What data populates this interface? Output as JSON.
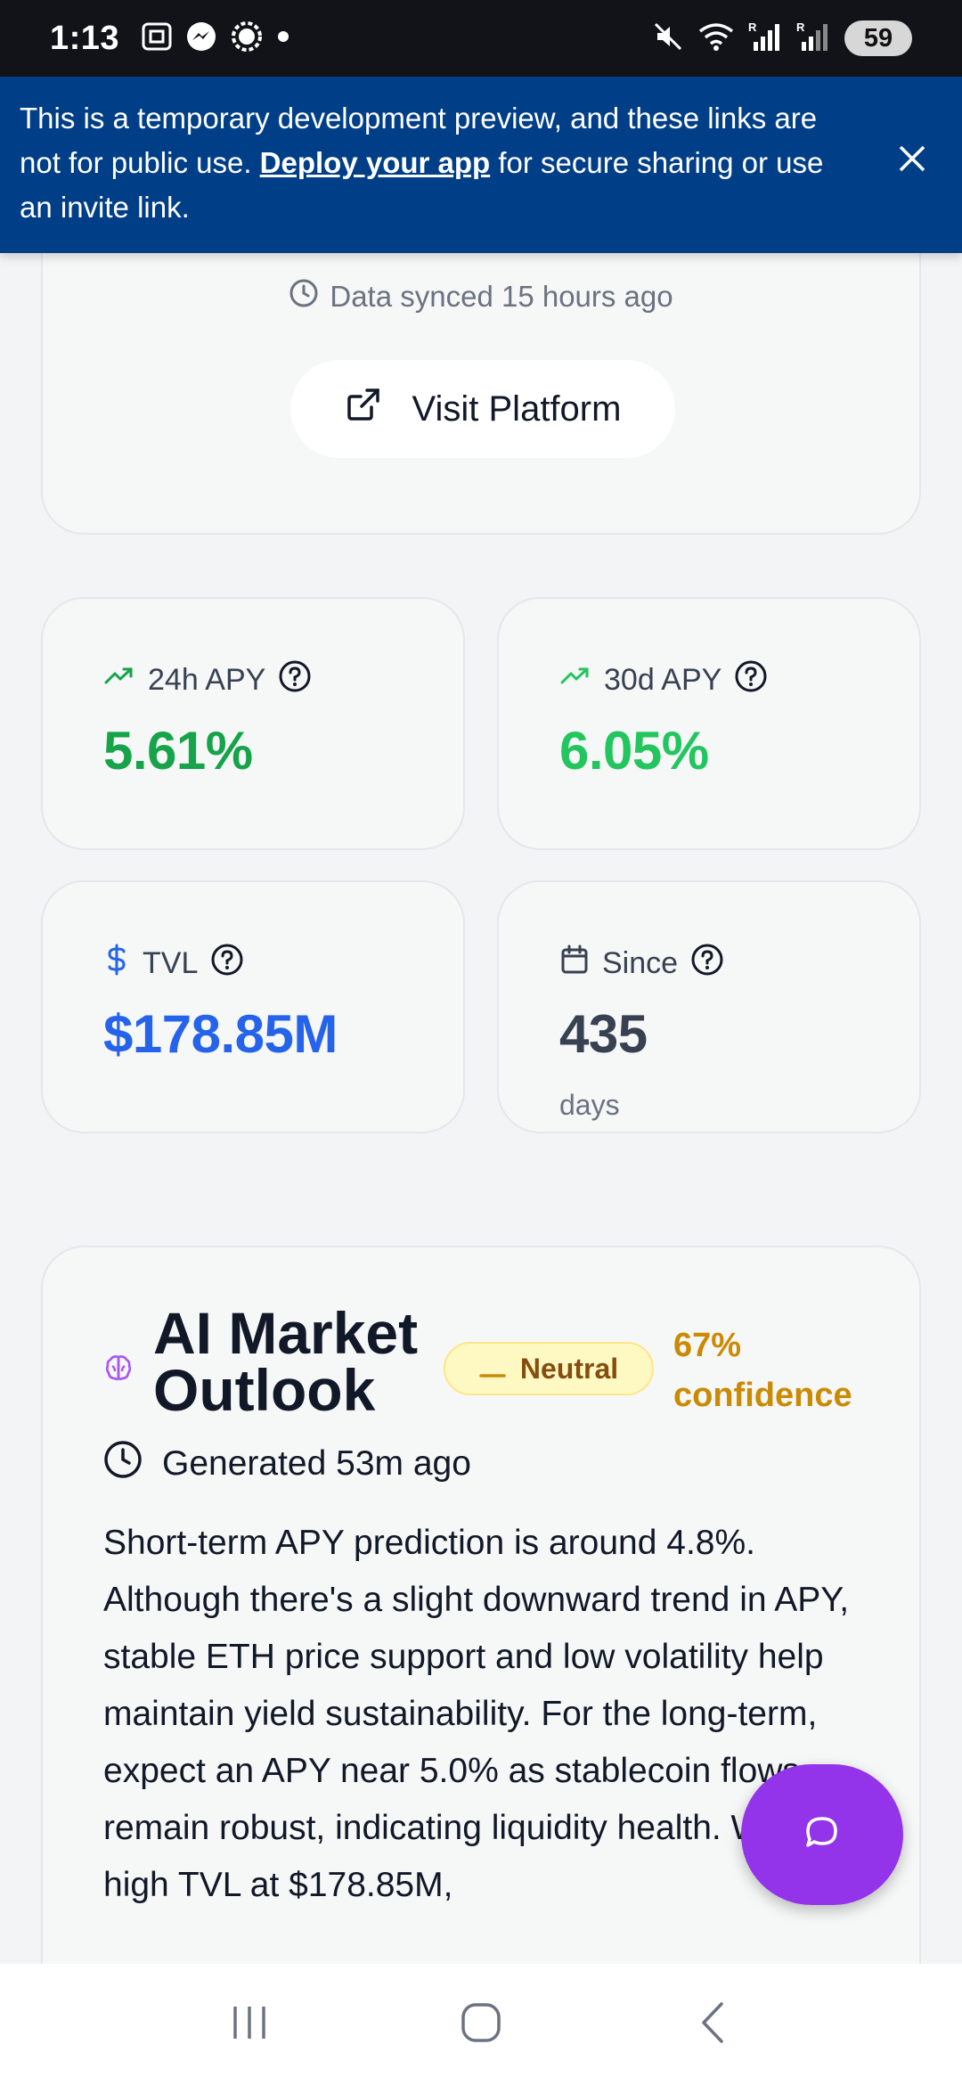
{
  "status_bar": {
    "time": "1:13",
    "battery": "59",
    "icons": [
      "screenshot-icon",
      "messenger-icon",
      "settings-icon",
      "dot-icon",
      "mute-icon",
      "wifi-icon",
      "signal-icon",
      "signal-icon-2"
    ]
  },
  "dev_banner": {
    "text_before": "This is a temporary development preview, and these links are not for public use. ",
    "link_text": "Deploy your app",
    "text_after": " for secure sharing or use an invite link.",
    "close_icon": "close-icon"
  },
  "platform_card": {
    "sync_text": "Data synced 15 hours ago",
    "visit_button": "Visit Platform"
  },
  "stats": {
    "apy_24h": {
      "label": "24h APY",
      "value": "5.61%",
      "color": "#16a34a"
    },
    "apy_30d": {
      "label": "30d APY",
      "value": "6.05%",
      "color": "#22c55e"
    },
    "tvl": {
      "label": "TVL",
      "value": "$178.85M",
      "color": "#2563eb"
    },
    "since": {
      "label": "Since",
      "value": "435",
      "unit": "days",
      "color": "#374151"
    }
  },
  "ai_outlook": {
    "title": "AI Market Outlook",
    "badge": "Neutral",
    "confidence": "67% confidence",
    "generated": "Generated 53m ago",
    "body": "Short-term APY prediction is around 4.8%. Although there's a slight downward trend in APY, stable ETH price support and low volatility help maintain yield sustainability. For the long-term, expect an APY near 5.0% as stablecoin flows remain robust, indicating liquidity health. With a high TVL at $178.85M,"
  },
  "colors": {
    "banner": "#003f87",
    "fab": "#9333ea",
    "neutral_badge_bg": "#fef9c3",
    "neutral_text": "#854d0e",
    "confidence": "#ca8a04"
  }
}
